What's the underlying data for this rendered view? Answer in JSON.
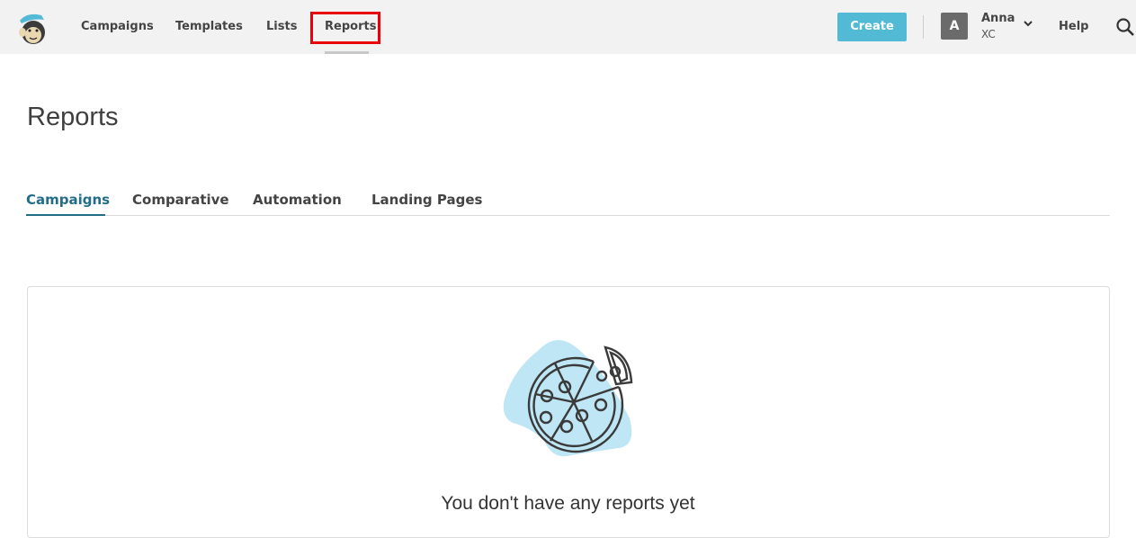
{
  "nav": {
    "items": [
      "Campaigns",
      "Templates",
      "Lists",
      "Reports"
    ],
    "active": "Reports",
    "create_label": "Create",
    "avatar_letter": "A",
    "user_name": "Anna",
    "account": "XC",
    "help_label": "Help"
  },
  "page": {
    "title": "Reports",
    "tabs": [
      "Campaigns",
      "Comparative",
      "Automation",
      "Landing Pages"
    ],
    "active_tab": "Campaigns"
  },
  "empty_state": {
    "message": "You don't have any reports yet"
  },
  "colors": {
    "accent": "#52bad5",
    "active_tab": "#236e87",
    "highlight_box": "#e8000b"
  },
  "icons": [
    "mailchimp-logo",
    "chevron-down-icon",
    "search-icon",
    "pizza-illustration"
  ]
}
